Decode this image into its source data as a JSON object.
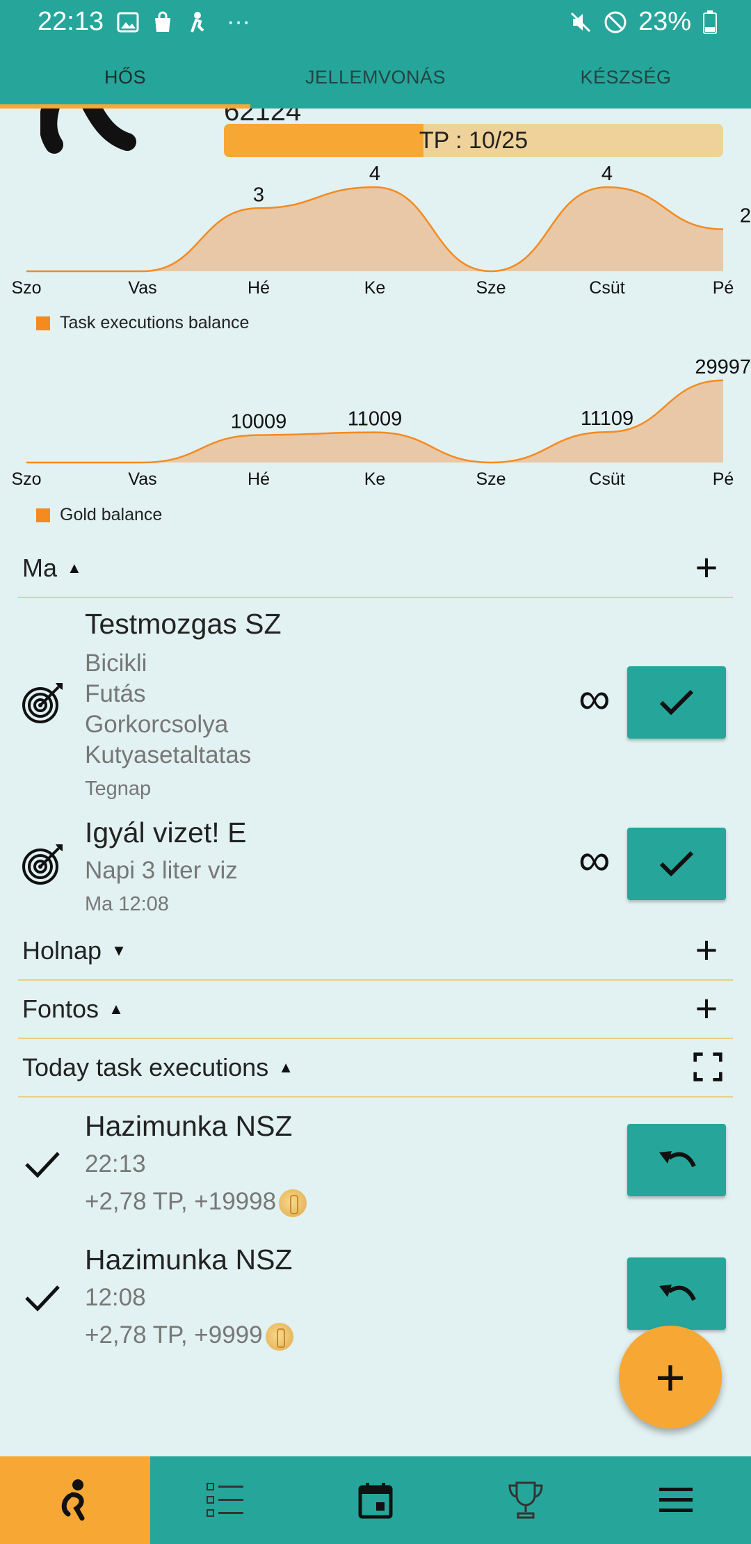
{
  "status_bar": {
    "time": "22:13",
    "battery": "23%",
    "left_icons": [
      "image-icon",
      "shopping-bag-icon",
      "person-icon",
      "more-icon"
    ],
    "right_icons": [
      "mute-icon",
      "do-not-disturb-icon",
      "battery-icon"
    ]
  },
  "tabs": [
    {
      "label": "HŐS",
      "active": true
    },
    {
      "label": "JELLEMVONÁS",
      "active": false
    },
    {
      "label": "KÉSZSÉG",
      "active": false
    }
  ],
  "hero": {
    "partial_value": "62124",
    "tp_label": "TP : 10/25",
    "tp_current": 10,
    "tp_max": 25
  },
  "chart_data": [
    {
      "type": "area",
      "categories": [
        "Szo",
        "Vas",
        "Hé",
        "Ke",
        "Sze",
        "Csüt",
        "Pé"
      ],
      "values": [
        0,
        0,
        3,
        4,
        0,
        4,
        2
      ],
      "data_labels": [
        "",
        "",
        "3",
        "4",
        "",
        "4",
        "2"
      ],
      "legend": "Task executions balance",
      "ylim": [
        0,
        4.3
      ]
    },
    {
      "type": "area",
      "categories": [
        "Szo",
        "Vas",
        "Hé",
        "Ke",
        "Sze",
        "Csüt",
        "Pé"
      ],
      "values": [
        0,
        0,
        10009,
        11009,
        0,
        11109,
        29997
      ],
      "data_labels": [
        "",
        "",
        "10009",
        "11009",
        "",
        "11109",
        "29997"
      ],
      "legend": "Gold balance",
      "ylim": [
        0,
        33000
      ]
    }
  ],
  "sections": {
    "ma": {
      "title": "Ma",
      "expanded": true
    },
    "holnap": {
      "title": "Holnap",
      "expanded": false
    },
    "fontos": {
      "title": "Fontos",
      "expanded": true
    },
    "today_exec": {
      "title": "Today task executions",
      "expanded": true
    }
  },
  "tasks": [
    {
      "title": "Testmozgas SZ",
      "lines": [
        "Bicikli",
        "Futás",
        "Gorkorcsolya",
        "Kutyasetaltatas"
      ],
      "meta": "Tegnap",
      "repeat": "∞",
      "icon": "target-icon"
    },
    {
      "title": "Igyál vizet! E",
      "lines": [
        "Napi 3 liter viz"
      ],
      "meta": "Ma 12:08",
      "repeat": "∞",
      "icon": "target-icon"
    }
  ],
  "executions": [
    {
      "title": "Hazimunka NSZ",
      "time": "22:13",
      "reward": "+2,78 TP, +19998"
    },
    {
      "title": "Hazimunka NSZ",
      "time": "12:08",
      "reward": "+2,78 TP, +9999"
    }
  ],
  "bottom_nav": [
    {
      "name": "hero-icon",
      "active": true
    },
    {
      "name": "list-icon",
      "active": false
    },
    {
      "name": "calendar-icon",
      "active": false
    },
    {
      "name": "trophy-icon",
      "active": false
    },
    {
      "name": "menu-icon",
      "active": false
    }
  ],
  "colors": {
    "primary": "#26a69a",
    "accent": "#f7a733",
    "background": "#e2f1f1",
    "chart_fill": "#e8c8a6",
    "chart_stroke": "#f58a1f"
  }
}
